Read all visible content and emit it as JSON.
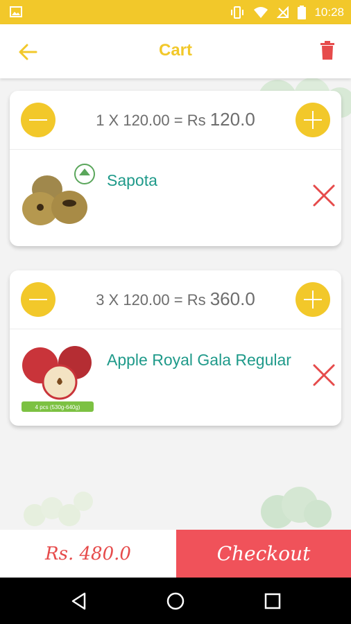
{
  "status_bar": {
    "time": "10:28"
  },
  "app_bar": {
    "title": "Cart"
  },
  "cart_items": [
    {
      "quantity_formula": "1 X 120.00 = Rs",
      "line_total": "120.0",
      "name": "Sapota"
    },
    {
      "quantity_formula": "3 X 120.00 = Rs",
      "line_total": "360.0",
      "name": "Apple Royal Gala Regular",
      "image_tag": "4 pcs (530g-640g)"
    }
  ],
  "footer": {
    "total": "Rs. 480.0",
    "checkout_label": "Checkout"
  },
  "colors": {
    "accent": "#f2c82a",
    "danger": "#e64b4b",
    "checkout": "#f0525a",
    "product_name": "#1f9a8a"
  }
}
